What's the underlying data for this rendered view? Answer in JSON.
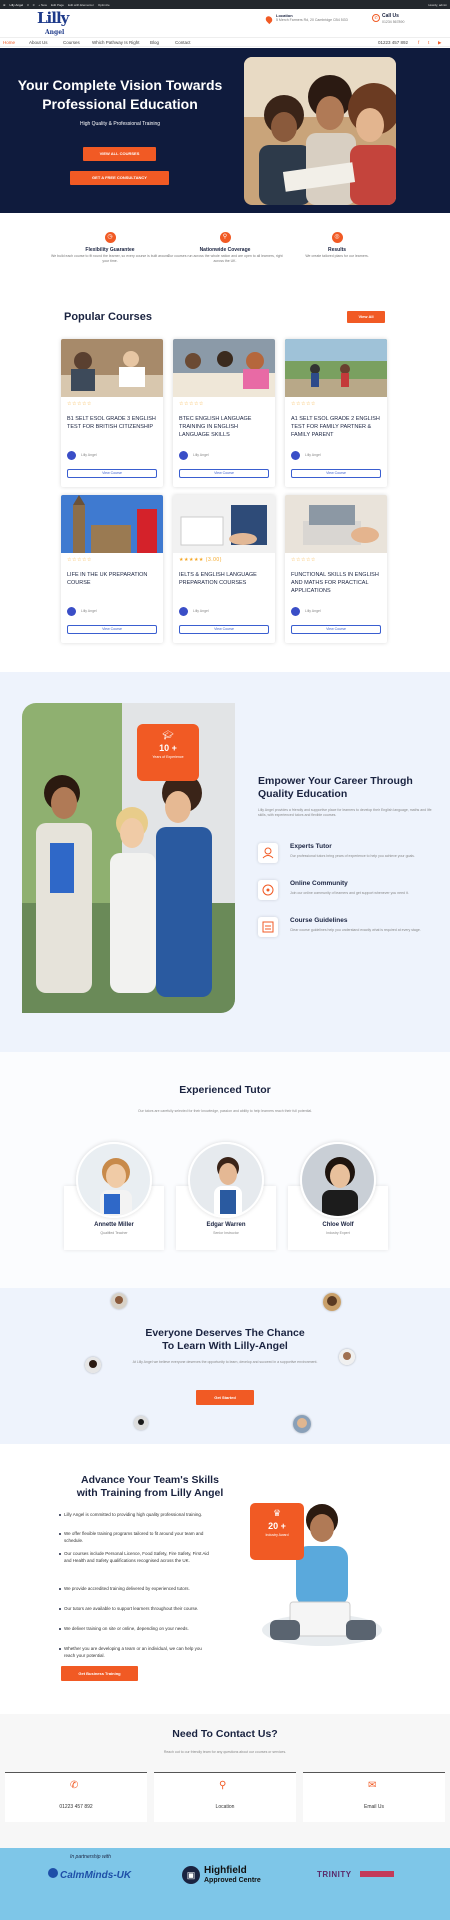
{
  "admin_bar": {
    "items": [
      "Lilly Angel",
      "3",
      "0",
      "+ New",
      "Edit Page",
      "Edit with Elementor",
      "Optimize"
    ],
    "user": "Howdy, admin"
  },
  "header": {
    "logo_text": "Lilly",
    "logo_sub": "Angel",
    "location_label": "Location",
    "location_value": "5 Merch Farmers Rd, 20 Cambridge CB4 5GD",
    "call_label": "Call Us",
    "call_value": "01234 567890"
  },
  "nav": {
    "items": [
      "Home",
      "About Us",
      "Courses",
      "Which Pathway Is Right",
      "Blog",
      "Contact"
    ],
    "phone": "01223 457 892",
    "social": [
      "f",
      "t",
      "▶"
    ]
  },
  "hero": {
    "title_line1": "Your Complete Vision Towards",
    "title_line2": "Professional Education",
    "subtitle": "High Quality & Professional Training",
    "btn_primary": "View All Courses",
    "btn_secondary": "Get A Free Consultancy"
  },
  "features": [
    {
      "title": "Flexibility Guarantee",
      "desc": "We build each course to fit round the learner, so every course is built around your time."
    },
    {
      "title": "Nationwide Coverage",
      "desc": "Our courses run across the whole nation and are open to all learners, right across the UK."
    },
    {
      "title": "Results",
      "desc": "We create tailored plans for our learners."
    }
  ],
  "courses": {
    "title": "Popular Courses",
    "view_all": "View All",
    "items": [
      {
        "stars": "☆☆☆☆☆",
        "title": "B1 SELT ESOL GRADE 3 ENGLISH TEST FOR BRITISH CITIZENSHIP",
        "author": "Lilly Angel",
        "btn": "View Course"
      },
      {
        "stars": "☆☆☆☆☆",
        "title": "BTEC ENGLISH LANGUAGE TRAINING IN ENGLISH LANGUAGE SKILLS",
        "author": "Lilly Angel",
        "btn": "View Course"
      },
      {
        "stars": "☆☆☆☆☆",
        "title": "A1 SELT ESOL GRADE 2 ENGLISH TEST FOR FAMILY PARTNER & FAMILY PARENT",
        "author": "Lilly Angel",
        "btn": "View Course"
      },
      {
        "stars": "☆☆☆☆☆",
        "title": "LIFE IN THE UK PREPARATION COURSE",
        "author": "Lilly Angel",
        "btn": "View Course"
      },
      {
        "stars": "★★★★★ (3.00)",
        "title": "IELTS & ENGLISH LANGUAGE PREPARATION COURSES",
        "author": "Lilly Angel",
        "btn": "View Course"
      },
      {
        "stars": "☆☆☆☆☆",
        "title": "FUNCTIONAL SKILLS IN ENGLISH AND MATHS FOR PRACTICAL APPLICATIONS",
        "author": "Lilly Angel",
        "btn": "View Course"
      }
    ]
  },
  "empower": {
    "badge_number": "10 +",
    "badge_label": "Years of Experience",
    "title_line1": "Empower Your Career Through",
    "title_line2": "Quality Education",
    "desc": "Lilly Angel provides a friendly and supportive place for learners to develop their English language, maths and life skills, with experienced tutors and flexible courses.",
    "items": [
      {
        "title": "Experts Tutor",
        "desc": "Our professional tutors bring years of experience to help you achieve your goals."
      },
      {
        "title": "Online Community",
        "desc": "Join our online community of learners and get support whenever you need it."
      },
      {
        "title": "Course Guidelines",
        "desc": "Clear course guidelines help you understand exactly what is required at every stage."
      }
    ]
  },
  "tutors": {
    "title": "Experienced Tutor",
    "desc": "Our tutors are carefully selected for their knowledge, passion and ability to help learners reach their full potential.",
    "items": [
      {
        "name": "Annette Miller",
        "role": "Qualified Teacher"
      },
      {
        "name": "Edgar Warren",
        "role": "Senior Instructor"
      },
      {
        "name": "Chloe Wolf",
        "role": "Industry Expert"
      }
    ]
  },
  "chance": {
    "title_line1": "Everyone Deserves The Chance",
    "title_line2": "To Learn With Lilly-Angel",
    "desc": "At Lilly Angel we believe everyone deserves the opportunity to learn, develop and succeed in a supportive environment.",
    "btn": "Get Started"
  },
  "advance": {
    "title_line1": "Advance Your Team's Skills",
    "title_line2": "with Training from Lilly Angel",
    "bullets": [
      "Lilly Angel is committed to providing high quality professional training.",
      "We offer flexible training programs tailored to fit around your team and schedule.",
      "Our courses include Personal Licence, Food Safety, Fire Safety, First Aid and Health and Safety qualifications recognised across the UK.",
      "We provide accredited training delivered by experienced tutors.",
      "Our tutors are available to support learners throughout their course.",
      "We deliver training on site or online, depending on your needs.",
      "Whether you are developing a team or an individual, we can help you reach your potential."
    ],
    "btn": "Get Business Training",
    "badge_number": "20 +",
    "badge_label": "Industry Award"
  },
  "contact": {
    "title": "Need To Contact Us?",
    "desc": "Reach out to our friendly team for any questions about our courses or services.",
    "items": [
      {
        "icon": "phone-icon",
        "label": "01223 457 892"
      },
      {
        "icon": "location-icon",
        "label": "Location"
      },
      {
        "icon": "email-icon",
        "label": "Email Us"
      }
    ]
  },
  "footer": {
    "partner_label": "In partnership with",
    "partners": [
      "CalmMinds-UK",
      "Highfield",
      "Approved Centre",
      "TRINITY"
    ]
  },
  "colors": {
    "accent": "#f15a24",
    "navy": "#0f1b3d",
    "light_bg": "#eef3fc",
    "footer": "#7ec6e8"
  }
}
